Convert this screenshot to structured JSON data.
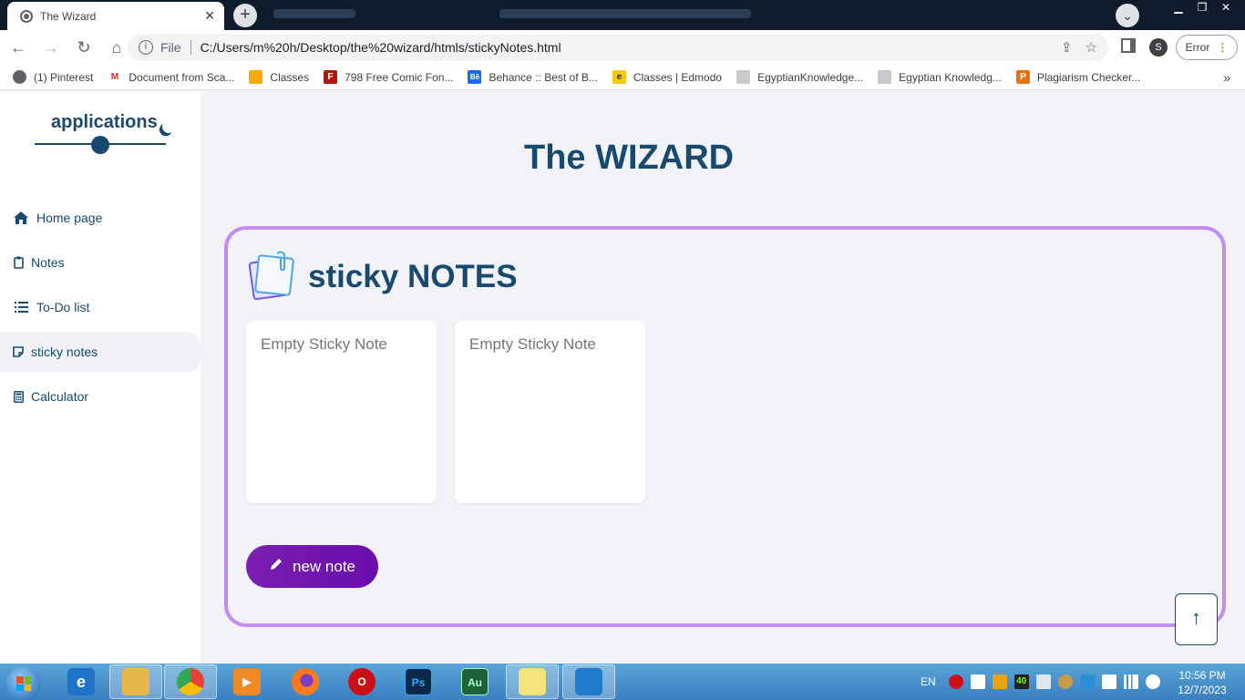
{
  "browser": {
    "tab_title": "The Wizard",
    "tab_close": "✕",
    "new_tab": "+",
    "file_label": "File",
    "url": "C:/Users/m%20h/Desktop/the%20wizard/htmls/stickyNotes.html",
    "profile_initial": "S",
    "error_label": "Error",
    "error_menu": "⋮",
    "bookmarks": [
      {
        "label": "(1) Pinterest",
        "icon": "globe-icon",
        "color": "#5f6368"
      },
      {
        "label": "Document from Sca...",
        "icon": "gmail-icon",
        "color": "#d93025"
      },
      {
        "label": "Classes",
        "icon": "classroom-icon",
        "color": "#1e8e3e"
      },
      {
        "label": "798 Free Comic Fon...",
        "icon": "fontspace-icon",
        "color": "#b3160a"
      },
      {
        "label": "Behance :: Best of B...",
        "icon": "behance-icon",
        "color": "#1769ff"
      },
      {
        "label": "Classes | Edmodo",
        "icon": "edmodo-icon",
        "color": "#f5c518"
      },
      {
        "label": "EgyptianKnowledge...",
        "icon": "ekb-icon",
        "color": "#9aa0a6"
      },
      {
        "label": "Egyptian Knowledg...",
        "icon": "ekb-icon",
        "color": "#9aa0a6"
      },
      {
        "label": "Plagiarism Checker...",
        "icon": "plagiarism-icon",
        "color": "#e8710a"
      }
    ],
    "bookmarks_more": "»"
  },
  "sidebar": {
    "app_title": "applications",
    "nav": [
      {
        "label": "Home page",
        "icon": "home-icon",
        "active": false
      },
      {
        "label": "Notes",
        "icon": "clipboard-icon",
        "active": false
      },
      {
        "label": "To-Do list",
        "icon": "list-icon",
        "active": false
      },
      {
        "label": "sticky notes",
        "icon": "sticky-note-icon",
        "active": true
      },
      {
        "label": "Calculator",
        "icon": "calculator-icon",
        "active": false
      }
    ]
  },
  "main": {
    "title": "The WIZARD",
    "section_title": "sticky NOTES",
    "notes": [
      {
        "placeholder": "Empty Sticky Note"
      },
      {
        "placeholder": "Empty Sticky Note"
      }
    ],
    "new_note_label": "new note",
    "scroll_top": "↑"
  },
  "taskbar": {
    "apps": [
      {
        "name": "internet-explorer-icon",
        "color": "#1e73c8",
        "label": "e"
      },
      {
        "name": "file-explorer-icon",
        "color": "#e8b84a",
        "label": ""
      },
      {
        "name": "chrome-icon",
        "color": "#e94235",
        "label": ""
      },
      {
        "name": "media-player-icon",
        "color": "#f08a24",
        "label": "▶"
      },
      {
        "name": "firefox-icon",
        "color": "#e66000",
        "label": ""
      },
      {
        "name": "opera-icon",
        "color": "#cc0f16",
        "label": "O"
      },
      {
        "name": "photoshop-icon",
        "color": "#0b2a4a",
        "label": "Ps"
      },
      {
        "name": "audition-icon",
        "color": "#1f5f3a",
        "label": "Au"
      },
      {
        "name": "sticky-notes-app-icon",
        "color": "#f5e27a",
        "label": ""
      },
      {
        "name": "vscode-icon",
        "color": "#1f7acc",
        "label": ""
      }
    ],
    "language": "EN",
    "tray_badge": "40",
    "time": "10:56 PM",
    "date": "12/7/2023"
  },
  "colors": {
    "primary": "#174a6e",
    "accent_border": "#c58cf0",
    "button_purple": "#6a0dad",
    "page_bg": "#f1f3f8"
  }
}
